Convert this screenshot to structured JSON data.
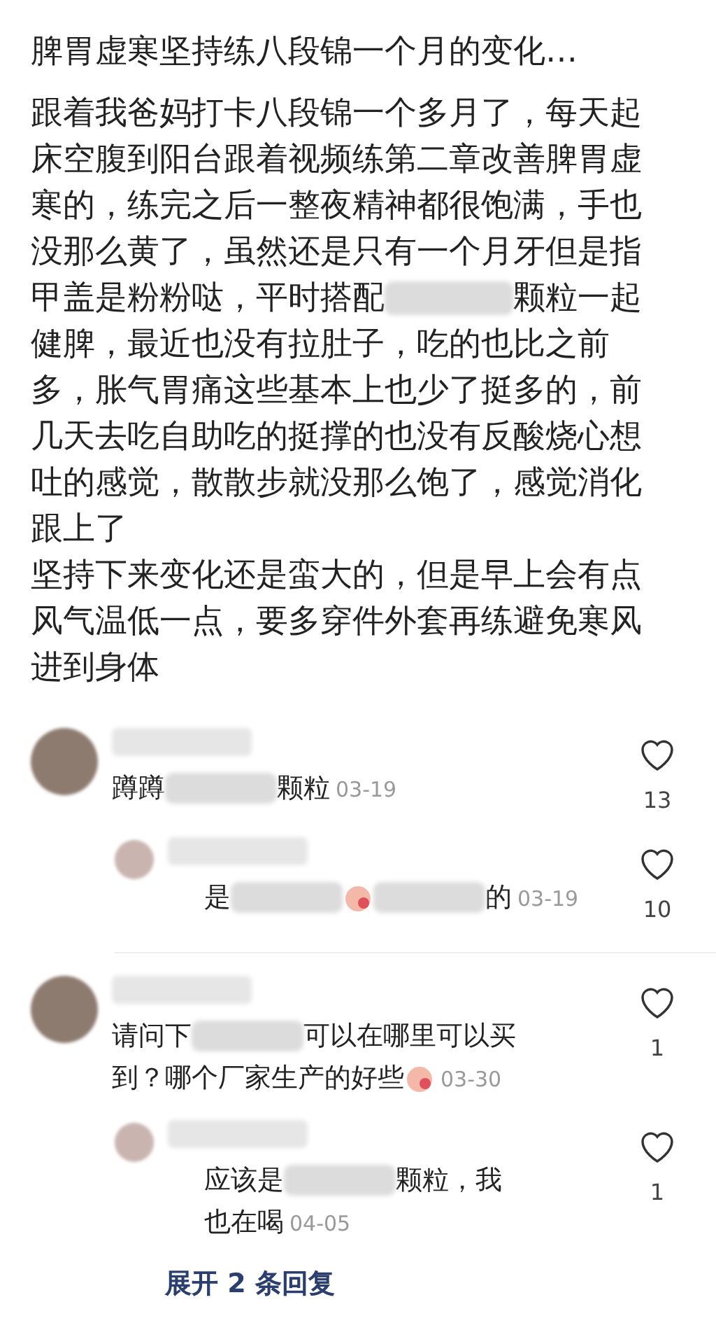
{
  "post": {
    "title": "脾胃虚寒坚持练八段锦一个月的变化…",
    "lines": [
      [
        {
          "kind": "text",
          "text": "跟着我爸妈打卡八段锦一个多月了，每天起"
        }
      ],
      [
        {
          "kind": "text",
          "text": "床空腹到阳台跟着视频练第二章改善脾胃虚"
        }
      ],
      [
        {
          "kind": "text",
          "text": "寒的，练完之后一整夜精神都很饱满，手也"
        }
      ],
      [
        {
          "kind": "text",
          "text": "没那么黄了，虽然还是只有一个月牙但是指"
        }
      ],
      [
        {
          "kind": "text",
          "text": "甲盖是粉粉哒，平时搭配"
        },
        {
          "kind": "blur"
        },
        {
          "kind": "text",
          "text": "颗粒一起"
        }
      ],
      [
        {
          "kind": "text",
          "text": "健脾，最近也没有拉肚子，吃的也比之前"
        }
      ],
      [
        {
          "kind": "text",
          "text": "多，胀气胃痛这些基本上也少了挺多的，前"
        }
      ],
      [
        {
          "kind": "text",
          "text": "几天去吃自助吃的挺撑的也没有反酸烧心想"
        }
      ],
      [
        {
          "kind": "text",
          "text": "吐的感觉，散散步就没那么饱了，感觉消化"
        }
      ],
      [
        {
          "kind": "text",
          "text": "跟上了"
        }
      ],
      [
        {
          "kind": "text",
          "text": "坚持下来变化还是蛮大的，但是早上会有点"
        }
      ],
      [
        {
          "kind": "text",
          "text": "风气温低一点，要多穿件外套再练避免寒风"
        }
      ],
      [
        {
          "kind": "text",
          "text": "进到身体"
        }
      ]
    ]
  },
  "comments": [
    {
      "lines": [
        [
          {
            "kind": "text",
            "text": "蹲蹲"
          },
          {
            "kind": "blur"
          },
          {
            "kind": "text",
            "text": "颗粒"
          }
        ]
      ],
      "date": "03-19",
      "likes": "13",
      "replies": [
        {
          "lines": [
            [
              {
                "kind": "text",
                "text": "是"
              },
              {
                "kind": "blur"
              },
              {
                "kind": "emoji"
              },
              {
                "kind": "blur"
              },
              {
                "kind": "text",
                "text": "的"
              }
            ]
          ],
          "date": "03-19",
          "likes": "10"
        }
      ]
    },
    {
      "lines": [
        [
          {
            "kind": "text",
            "text": "请问下"
          },
          {
            "kind": "blur"
          },
          {
            "kind": "text",
            "text": "可以在哪里可以买"
          }
        ],
        [
          {
            "kind": "text",
            "text": "到？哪个厂家生产的好些"
          },
          {
            "kind": "emoji"
          }
        ]
      ],
      "date": "03-30",
      "likes": "1",
      "replies": [
        {
          "lines": [
            [
              {
                "kind": "text",
                "text": "应该是"
              },
              {
                "kind": "blur"
              },
              {
                "kind": "text",
                "text": "颗粒，我"
              }
            ],
            [
              {
                "kind": "text",
                "text": "也在喝"
              }
            ]
          ],
          "date": "04-05",
          "likes": "1"
        }
      ],
      "more_replies": "展开 2 条回复"
    }
  ]
}
